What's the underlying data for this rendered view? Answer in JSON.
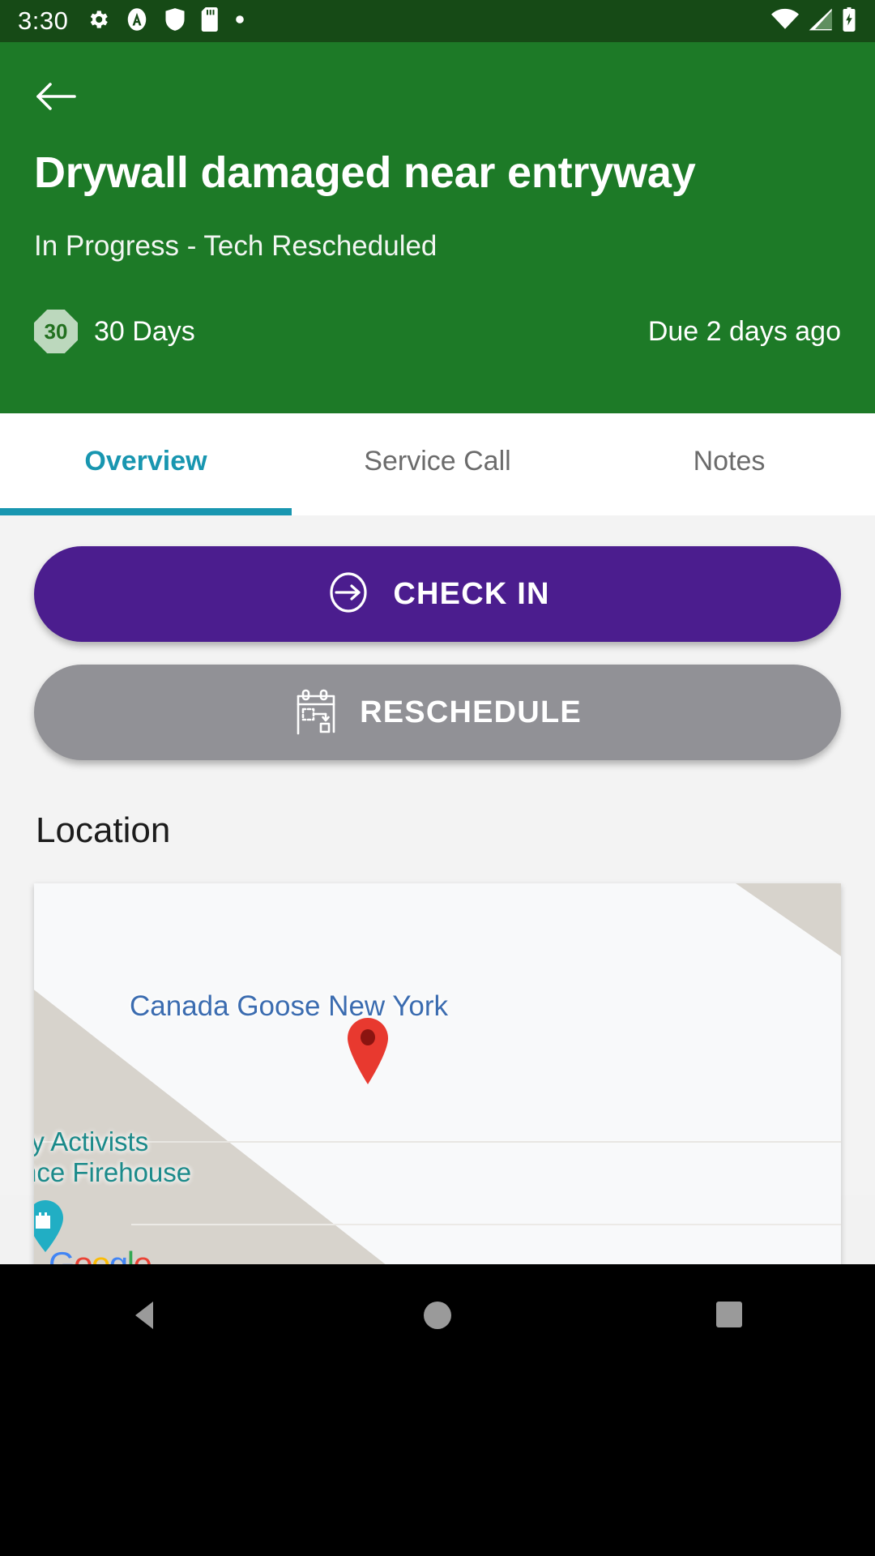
{
  "status_bar": {
    "time": "3:30",
    "left_icons": [
      "gear-icon",
      "assistant-circle-icon",
      "shield-icon",
      "sd-card-icon",
      "dot-icon"
    ],
    "right_icons": [
      "wifi-icon",
      "cellular-signal-icon",
      "battery-charging-icon"
    ]
  },
  "header": {
    "back_icon": "arrow-left-icon",
    "title": "Drywall damaged near entryway",
    "status": "In Progress - Tech Rescheduled",
    "sla_badge_value": "30",
    "sla_label": "30 Days",
    "due_text": "Due 2 days ago",
    "bg_color": "#1d7a27"
  },
  "tabs": [
    {
      "label": "Overview",
      "active": true
    },
    {
      "label": "Service Call",
      "active": false
    },
    {
      "label": "Notes",
      "active": false
    }
  ],
  "tab_accent_color": "#1896b0",
  "actions": {
    "check_in": {
      "label": "CHECK IN",
      "icon": "arrow-right-circle-icon",
      "color": "#4b1d8e"
    },
    "reschedule": {
      "label": "RESCHEDULE",
      "icon": "calendar-move-icon",
      "color": "#919196"
    }
  },
  "location": {
    "section_title": "Location",
    "map": {
      "primary_poi": "Canada Goose New York",
      "primary_poi_color": "#3b6cb0",
      "marker_icon": "map-pin-icon",
      "marker_color": "#e8392f",
      "secondary_poi_line1": "ay Activists",
      "secondary_poi_line2": "liance Firehouse",
      "secondary_poi_color": "#1b8a8a",
      "secondary_marker_icon": "castle-pin-icon",
      "attribution": "Google",
      "attribution_letters": [
        "G",
        "o",
        "o",
        "g",
        "l",
        "e"
      ]
    }
  },
  "nav_bar": {
    "back": "triangle-back-icon",
    "home": "circle-home-icon",
    "recents": "square-recents-icon"
  }
}
